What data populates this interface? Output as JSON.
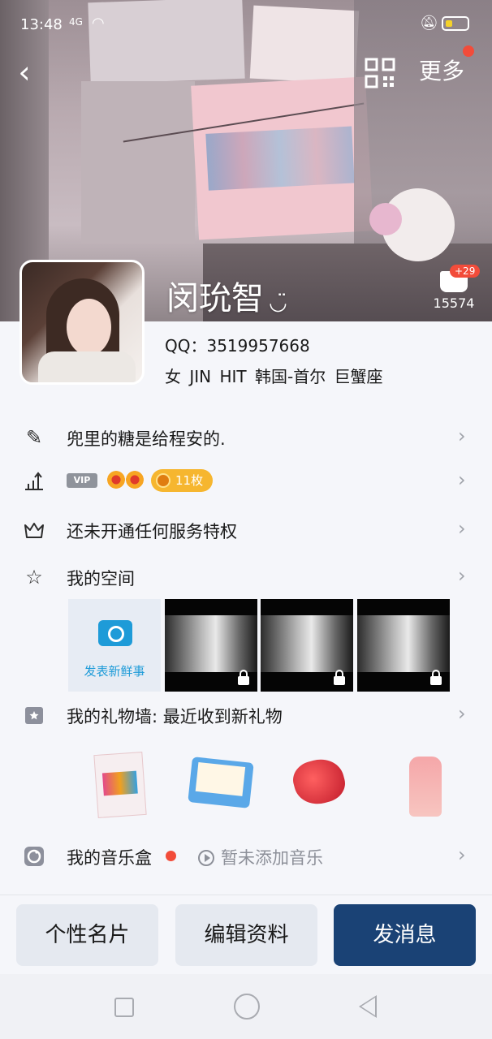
{
  "status_bar": {
    "time": "13:48",
    "network": "4G",
    "battery_level": 0.3
  },
  "header": {
    "more_label": "更多"
  },
  "profile": {
    "nickname": "闵玧智",
    "nickname_emoji": "◡̈",
    "likes_plus": "+29",
    "likes_count": "15574",
    "qq_line": "QQ：3519957668",
    "info_line": "女  JIN HIT  韩国-首尔  巨蟹座"
  },
  "rows": {
    "signature": "兜里的糖是给程安的.",
    "vip_tag": "VIP",
    "coins": "11枚",
    "privilege": "还未开通任何服务特权",
    "space": "我的空间",
    "post_new": "发表新鲜事",
    "gift_wall": "我的礼物墙: 最近收到新礼物",
    "music_box": "我的音乐盒",
    "music_empty": "暂未添加音乐"
  },
  "buttons": {
    "card": "个性名片",
    "edit": "编辑资料",
    "message": "发消息"
  },
  "icons": {
    "back": "back-arrow-icon",
    "qr": "qr-code-icon",
    "signature": "pencil-icon",
    "level": "level-chart-icon",
    "privilege": "crown-icon",
    "space": "star-icon",
    "gift": "gift-icon",
    "music": "music-disc-icon",
    "arrow": "chevron-right-icon"
  },
  "colors": {
    "primary": "#1a4275",
    "accent_blue": "#1e9bd8",
    "badge_red": "#f24c3a",
    "coin_orange": "#f6b62f"
  }
}
